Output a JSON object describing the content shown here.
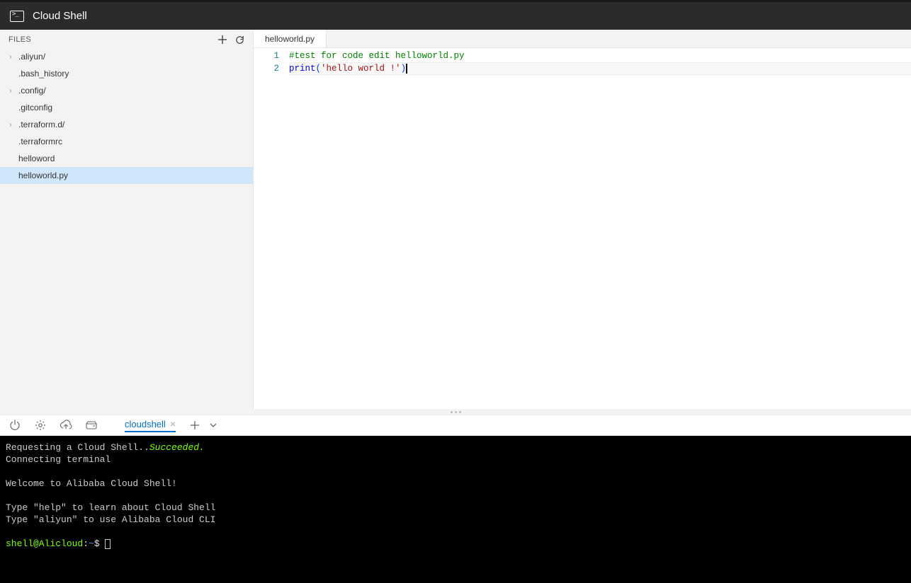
{
  "header": {
    "title": "Cloud Shell"
  },
  "sidebar": {
    "title": "FILES",
    "items": [
      {
        "label": ".aliyun/",
        "expandable": true
      },
      {
        "label": ".bash_history",
        "expandable": false
      },
      {
        "label": ".config/",
        "expandable": true
      },
      {
        "label": ".gitconfig",
        "expandable": false
      },
      {
        "label": ".terraform.d/",
        "expandable": true
      },
      {
        "label": ".terraformrc",
        "expandable": false
      },
      {
        "label": "helloword",
        "expandable": false
      },
      {
        "label": "helloworld.py",
        "expandable": false,
        "selected": true
      }
    ]
  },
  "editor": {
    "tab": "helloworld.py",
    "lines": {
      "l1_num": "1",
      "l2_num": "2",
      "l1_comment": "#test for code edit helloworld.py",
      "l2_func": "print",
      "l2_open": "(",
      "l2_string": "'hello world !'",
      "l2_close": ")"
    }
  },
  "term_toolbar": {
    "tab": "cloudshell"
  },
  "terminal": {
    "line1a": "Requesting a Cloud Shell..",
    "line1b": "Succeeded.",
    "line2": "Connecting terminal",
    "line3": "",
    "line4": "Welcome to Alibaba Cloud Shell!",
    "line5": "",
    "line6": "Type \"help\" to learn about Cloud Shell",
    "line7": "Type \"aliyun\" to use Alibaba Cloud CLI",
    "line8": "",
    "prompt_user": "shell@Alicloud",
    "prompt_colon": ":",
    "prompt_path": "~",
    "prompt_sym": "$ "
  }
}
